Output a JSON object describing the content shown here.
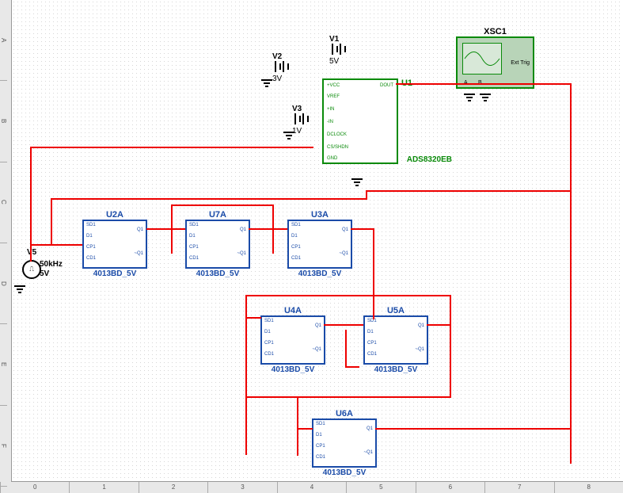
{
  "scope": {
    "ref": "XSC1",
    "ext": "Ext Trig",
    "a": "A",
    "b": "B"
  },
  "v1": {
    "ref": "V1",
    "val": "5V"
  },
  "v2": {
    "ref": "V2",
    "val": "3V"
  },
  "v3": {
    "ref": "V3",
    "val": "1V"
  },
  "v5": {
    "ref": "V5",
    "freq": "50kHz",
    "val": "5V"
  },
  "u1": {
    "ref": "U1",
    "part": "ADS8320EB",
    "pins": [
      "+VCC",
      "VREF",
      "+IN",
      "-IN",
      "DCLOCK",
      "CS/SHDN",
      "GND",
      "DOUT"
    ]
  },
  "u2": {
    "ref": "U2A",
    "part": "4013BD_5V"
  },
  "u3": {
    "ref": "U3A",
    "part": "4013BD_5V"
  },
  "u4": {
    "ref": "U4A",
    "part": "4013BD_5V"
  },
  "u5": {
    "ref": "U5A",
    "part": "4013BD_5V"
  },
  "u6": {
    "ref": "U6A",
    "part": "4013BD_5V"
  },
  "u7": {
    "ref": "U7A",
    "part": "4013BD_5V"
  },
  "ff_pins": {
    "sd": "SD1",
    "d": "D1",
    "cp": "CP1",
    "cd": "CD1",
    "q": "Q1",
    "qn": "~Q1"
  },
  "ruler_h": [
    "0",
    "1",
    "2",
    "3",
    "4",
    "5",
    "6",
    "7",
    "8"
  ],
  "ruler_v": [
    "A",
    "B",
    "C",
    "D",
    "E",
    "F"
  ]
}
